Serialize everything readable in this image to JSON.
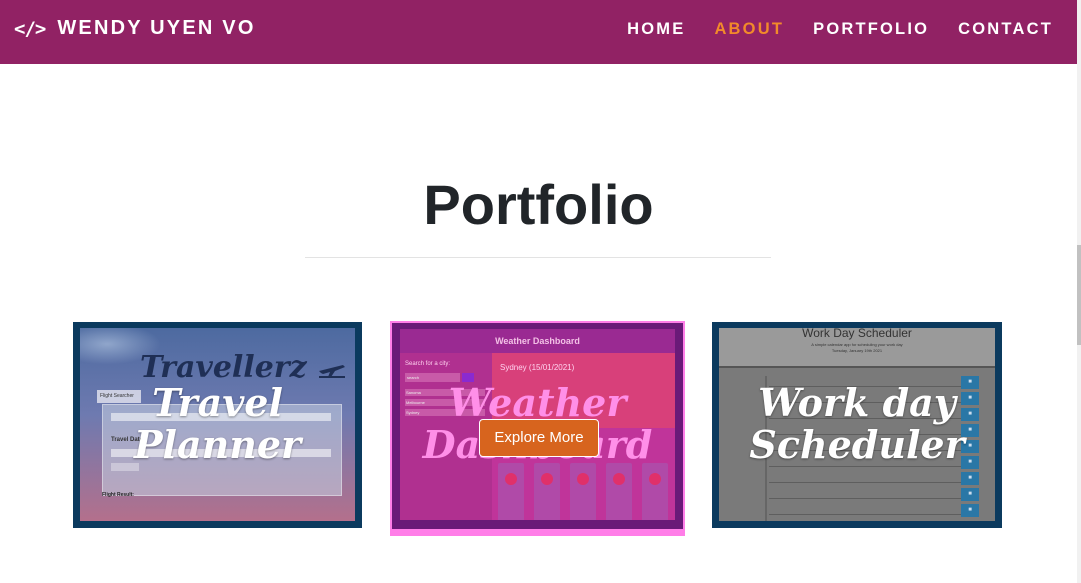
{
  "nav": {
    "brand_icon": "</>",
    "brand": "WENDY UYEN VO",
    "items": [
      {
        "label": "HOME",
        "active": false
      },
      {
        "label": "ABOUT",
        "active": true
      },
      {
        "label": "PORTFOLIO",
        "active": false
      },
      {
        "label": "CONTACT",
        "active": false
      }
    ]
  },
  "colors": {
    "navbar": "#912264",
    "active_nav": "#f28a2a",
    "explore_button": "#d7641e",
    "card_frame": "#0b3a5e",
    "highlight_frame": "#ff7ee8"
  },
  "section": {
    "title": "Portfolio"
  },
  "projects": [
    {
      "label_line1": "Travel",
      "label_line2": "Planner",
      "shot": {
        "logo": "Travellerz",
        "tab": "Flight Searcher",
        "dates_label": "Travel Dates",
        "result_label": "Flight Result:"
      }
    },
    {
      "label_line1": "Weather",
      "label_line2": "Dashboard",
      "explore_label": "Explore More",
      "shot": {
        "header": "Weather Dashboard",
        "search_label": "Search for a city:",
        "city": "Sydney (15/01/2021)",
        "search_placeholder": "search",
        "cities": [
          "Sanoma",
          "Melbourne",
          "Sydney"
        ]
      }
    },
    {
      "label_line1": "Work day",
      "label_line2": "Scheduler",
      "shot": {
        "header": "Work Day Scheduler",
        "subtitle": "A simple calendar app for scheduling your work day",
        "date": "Tuesday, January 19th 2021"
      }
    }
  ]
}
